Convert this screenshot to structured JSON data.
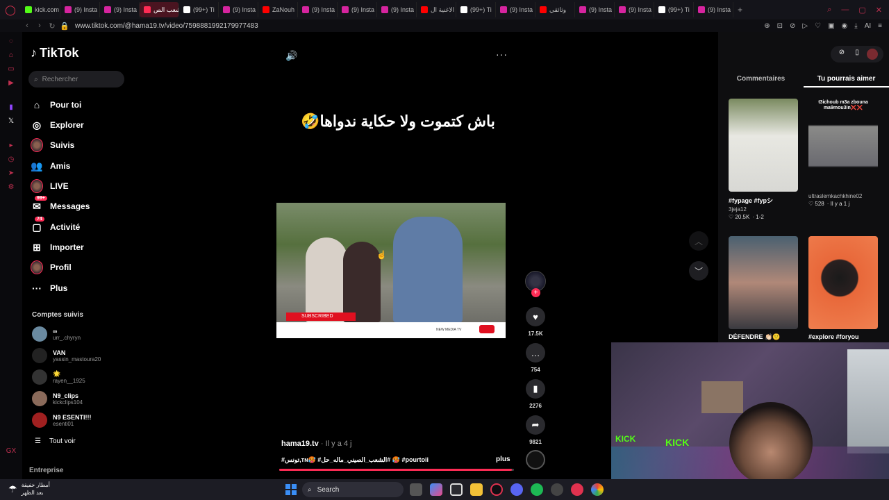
{
  "browser": {
    "tabs": [
      {
        "label": "kick.com",
        "color": "#53fc18"
      },
      {
        "label": "(9) Insta",
        "color": "#d6249f"
      },
      {
        "label": "(9) Insta",
        "color": "#d6249f"
      },
      {
        "label": "الشعب الص",
        "color": "#fe2c55",
        "active": true
      },
      {
        "label": "(99+) Ti",
        "color": "#ffffff"
      },
      {
        "label": "(9) Insta",
        "color": "#d6249f"
      },
      {
        "label": "ZaNouh",
        "color": "#ff0000"
      },
      {
        "label": "(9) Insta",
        "color": "#d6249f"
      },
      {
        "label": "(9) Insta",
        "color": "#d6249f"
      },
      {
        "label": "(9) Insta",
        "color": "#d6249f"
      },
      {
        "label": "الاغنية ال",
        "color": "#ff0000"
      },
      {
        "label": "(99+) Ti",
        "color": "#ffffff"
      },
      {
        "label": "(9) Insta",
        "color": "#d6249f"
      },
      {
        "label": "وثائقي",
        "color": "#ff0000"
      },
      {
        "label": "(9) Insta",
        "color": "#d6249f"
      },
      {
        "label": "(9) Insta",
        "color": "#d6249f"
      },
      {
        "label": "(99+) Ti",
        "color": "#ffffff"
      },
      {
        "label": "(9) Insta",
        "color": "#d6249f"
      }
    ],
    "url": "www.tiktok.com/@hama19.tv/video/7598881992179977483",
    "ai_label": "AI"
  },
  "tiktok": {
    "logo": "TikTok",
    "search_placeholder": "Rechercher",
    "nav": [
      {
        "label": "Pour toi",
        "icon": "home-icon",
        "glyph": "⌂"
      },
      {
        "label": "Explorer",
        "icon": "compass-icon",
        "glyph": "◎"
      },
      {
        "label": "Suivis",
        "icon": "following-avatar-icon",
        "glyph": ""
      },
      {
        "label": "Amis",
        "icon": "friends-icon",
        "glyph": "👥"
      },
      {
        "label": "LIVE",
        "icon": "live-avatar-icon",
        "glyph": ""
      },
      {
        "label": "Messages",
        "icon": "messages-icon",
        "glyph": "✉",
        "badge": "99+"
      },
      {
        "label": "Activité",
        "icon": "activity-icon",
        "glyph": "▢",
        "badge": "74"
      },
      {
        "label": "Importer",
        "icon": "upload-icon",
        "glyph": "⊞"
      },
      {
        "label": "Profil",
        "icon": "profile-avatar-icon",
        "glyph": ""
      },
      {
        "label": "Plus",
        "icon": "more-icon",
        "glyph": "···"
      }
    ],
    "following_title": "Comptes suivis",
    "following": [
      {
        "name": "∞",
        "handle": "urr_.chyryn"
      },
      {
        "name": "VAN",
        "handle": "yassin_mastoura20"
      },
      {
        "name": "🌟",
        "handle": "rayen__1925"
      },
      {
        "name": "N9_clips",
        "handle": "kickclips104"
      },
      {
        "name": "N9 ESENTI!!!",
        "handle": "esenti01"
      }
    ],
    "see_all": "Tout voir",
    "enterprise": "Entreprise"
  },
  "video": {
    "caption_overlay": "باش كتموت ولا حكاية ندواها🤣",
    "subscribed_label": "SUBSCRIBED",
    "watermark": "NEW MEDIA TV",
    "author": "hama19.tv",
    "time": "· Il y a 4 j",
    "tags": "#تونس,ᴛɴ🥵 #الشعب_الصيني_ماله_حل# 🥵 #pourtoii",
    "more_label": "plus",
    "progress": 0.99,
    "likes": "17.5K",
    "comments": "754",
    "saves": "2276",
    "shares": "9821"
  },
  "panel": {
    "tabs": [
      "Commentaires",
      "Tu pourrais aimer"
    ],
    "active_tab": 1,
    "cards": [
      {
        "title": "#fypage #fypシ",
        "author": "3jeja12",
        "likes": "20.5K",
        "extra": "· 1-2",
        "overlay": ""
      },
      {
        "title": "",
        "author": "ultraslemkachkhine02",
        "likes": "528",
        "extra": "· Il y a 1 j",
        "overlay": "t3ichoub m3a zbouna ma9mou3in❌❌"
      },
      {
        "title": "DÉFENDRE 👏🏻🙂",
        "author": "",
        "likes": "",
        "extra": "",
        "overlay": ""
      },
      {
        "title": "#explore #foryou",
        "author": "",
        "likes": "",
        "extra": "",
        "overlay": ""
      }
    ]
  },
  "taskbar": {
    "weather_line1": "أمطار خفيفة",
    "weather_line2": "بعد الظهر",
    "search_label": "Search"
  },
  "webcam": {
    "sign1": "KICK",
    "sign2": "KICK"
  },
  "colors": {
    "accent": "#fe2c55",
    "kick": "#53fc18",
    "opera": "#e0324f"
  }
}
